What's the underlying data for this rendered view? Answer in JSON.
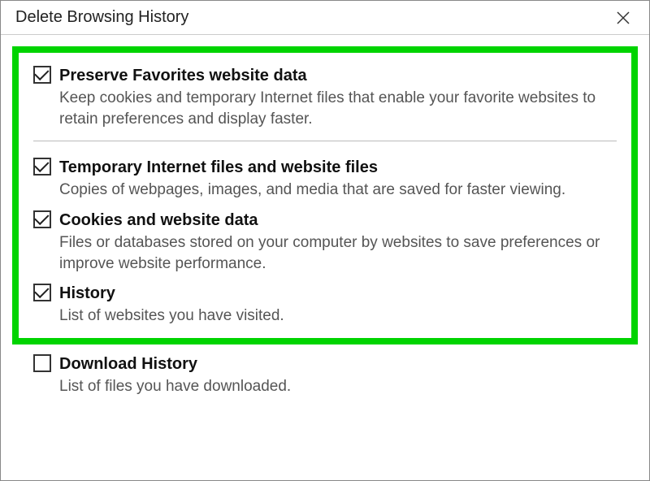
{
  "window": {
    "title": "Delete Browsing History"
  },
  "options": {
    "preserve_favorites": {
      "label": "Preserve Favorites website data",
      "desc": "Keep cookies and temporary Internet files that enable your favorite websites to retain preferences and display faster.",
      "checked": true
    },
    "temp_files": {
      "label": "Temporary Internet files and website files",
      "desc": "Copies of webpages, images, and media that are saved for faster viewing.",
      "checked": true
    },
    "cookies": {
      "label": "Cookies and website data",
      "desc": "Files or databases stored on your computer by websites to save preferences or improve website performance.",
      "checked": true
    },
    "history": {
      "label": "History",
      "desc": "List of websites you have visited.",
      "checked": true
    },
    "download_history": {
      "label": "Download History",
      "desc": "List of files you have downloaded.",
      "checked": false
    }
  },
  "highlight_color": "#00d400"
}
